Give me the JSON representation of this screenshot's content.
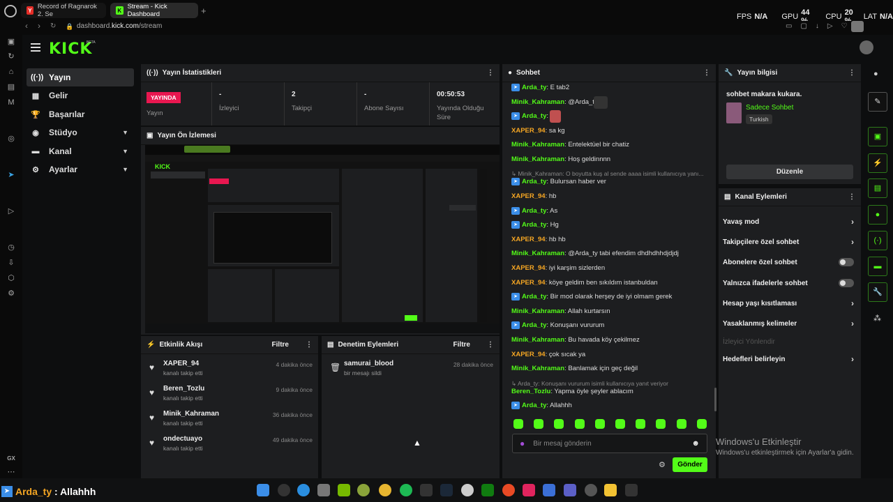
{
  "browser": {
    "tabs": [
      {
        "label": "Record of Ragnarok 2. Se",
        "favicon": "Y",
        "color": "#e52d27"
      },
      {
        "label": "Stream - Kick Dashboard",
        "favicon": "K",
        "color": "#53fc18"
      }
    ],
    "new_tab": "+",
    "url_prefix": "dashboard.",
    "url_domain": "kick.com",
    "url_path": "/stream"
  },
  "hud": {
    "fps_label": "FPS",
    "fps_value": "N/A",
    "gpu_label": "GPU",
    "gpu_value": "44 %",
    "cpu_label": "CPU",
    "cpu_value": "20 %",
    "lat_label": "LAT",
    "lat_value": "N/A"
  },
  "app": {
    "logo": "KICK",
    "logo_beta": "BETA",
    "nav": [
      {
        "label": "Yayın",
        "icon": "broadcast-icon"
      },
      {
        "label": "Gelir",
        "icon": "revenue-icon"
      },
      {
        "label": "Başarılar",
        "icon": "trophy-icon"
      },
      {
        "label": "Stüdyo",
        "icon": "studio-icon"
      },
      {
        "label": "Kanal",
        "icon": "channel-icon"
      },
      {
        "label": "Ayarlar",
        "icon": "gear-icon"
      }
    ]
  },
  "stats": {
    "title": "Yayın İstatistikleri",
    "live_badge": "YAYINDA",
    "live_label": "Yayın",
    "items": [
      {
        "value": "-",
        "label": "İzleyici"
      },
      {
        "value": "2",
        "label": "Takipçi"
      },
      {
        "value": "-",
        "label": "Abone Sayısı"
      },
      {
        "value": "00:50:53",
        "label": "Yayında Olduğu Süre"
      }
    ]
  },
  "preview": {
    "title": "Yayın Ön İzlemesi"
  },
  "activity": {
    "title": "Etkinlik Akışı",
    "filter": "Filtre",
    "items": [
      {
        "name": "XAPER_94",
        "sub": "kanalı takip etti",
        "time": "4 dakika önce"
      },
      {
        "name": "Beren_Tozlu",
        "sub": "kanalı takip etti",
        "time": "9 dakika önce"
      },
      {
        "name": "Minik_Kahraman",
        "sub": "kanalı takip etti",
        "time": "36 dakika önce"
      },
      {
        "name": "ondectuayo",
        "sub": "kanalı takip etti",
        "time": "49 dakika önce"
      }
    ]
  },
  "moderation": {
    "title": "Denetim Eylemleri",
    "filter": "Filtre",
    "items": [
      {
        "name": "samurai_blood",
        "sub": "bir mesajı sildi",
        "time": "28 dakika önce"
      }
    ]
  },
  "chat": {
    "title": "Sohbet",
    "messages": [
      {
        "user": "Arda_ty",
        "sep": ": ",
        "text": "E tab2",
        "color": "#53fc18",
        "badge": true
      },
      {
        "user": "Minik_Kahraman",
        "sep": ": ",
        "text": "@Arda_ty",
        "color": "#53fc18",
        "badge": false
      },
      {
        "user": "Arda_ty",
        "sep": ":",
        "text": "",
        "color": "#53fc18",
        "badge": true
      },
      {
        "user": "XAPER_94",
        "sep": ": ",
        "text": "sa kg",
        "color": "#f5a623",
        "badge": false
      },
      {
        "user": "Minik_Kahraman",
        "sep": ": ",
        "text": "Entelektüel bir chatiz",
        "color": "#53fc18",
        "badge": false
      },
      {
        "user": "Minik_Kahraman",
        "sep": ": ",
        "text": "Hoş geldinnnn",
        "color": "#53fc18",
        "badge": false
      },
      {
        "reply": "↳ Minik_Kahraman: O boyutta kuş al sende aaaa isimli kullanıcıya yanı..."
      },
      {
        "user": "Arda_ty",
        "sep": ": ",
        "text": "Bulursan haber ver",
        "color": "#53fc18",
        "badge": true
      },
      {
        "user": "XAPER_94",
        "sep": ": ",
        "text": "hb",
        "color": "#f5a623",
        "badge": false
      },
      {
        "user": "Arda_ty",
        "sep": ": ",
        "text": "As",
        "color": "#53fc18",
        "badge": true
      },
      {
        "user": "Arda_ty",
        "sep": ": ",
        "text": "Hg",
        "color": "#53fc18",
        "badge": true
      },
      {
        "user": "XAPER_94",
        "sep": ": ",
        "text": "hb hb",
        "color": "#f5a623",
        "badge": false
      },
      {
        "user": "Minik_Kahraman",
        "sep": ": ",
        "text": "@Arda_ty tabi efendim dhdhdhhdjdjdj",
        "color": "#53fc18",
        "badge": false
      },
      {
        "user": "XAPER_94",
        "sep": ": ",
        "text": "iyi karşim sizlerden",
        "color": "#f5a623",
        "badge": false
      },
      {
        "user": "XAPER_94",
        "sep": ": ",
        "text": "köye geldim ben sıkıldım istanbuldan",
        "color": "#f5a623",
        "badge": false
      },
      {
        "user": "Arda_ty",
        "sep": ": ",
        "text": "Bir mod olarak herşey de iyi olmam gerek",
        "color": "#53fc18",
        "badge": true
      },
      {
        "user": "Minik_Kahraman",
        "sep": ": ",
        "text": "Allah kurtarsın",
        "color": "#53fc18",
        "badge": false
      },
      {
        "user": "Arda_ty",
        "sep": ": ",
        "text": "Konuşanı vururum",
        "color": "#53fc18",
        "badge": true
      },
      {
        "user": "Minik_Kahraman",
        "sep": ": ",
        "text": "Bu havada köy çekilmez",
        "color": "#53fc18",
        "badge": false
      },
      {
        "user": "XAPER_94",
        "sep": ": ",
        "text": "çok sıcak ya",
        "color": "#f5a623",
        "badge": false
      },
      {
        "user": "Minik_Kahraman",
        "sep": ": ",
        "text": "Banlamak için geç değil",
        "color": "#53fc18",
        "badge": false
      },
      {
        "reply": "↳ Arda_ty: Konuşanı vururum isimli kullanıcıya yanıt veriyor"
      },
      {
        "user": "Beren_Tozlu",
        "sep": ": ",
        "text": "Yapma öyle şeyler ablacım",
        "color": "#53fc18",
        "badge": false
      },
      {
        "user": "Arda_ty",
        "sep": ": ",
        "text": "Allahhh",
        "color": "#53fc18",
        "badge": true
      }
    ],
    "input_placeholder": "Bir mesaj gönderin",
    "send": "Gönder"
  },
  "stream_info": {
    "title": "Yayın bilgisi",
    "stream_title": "sohbet makara kukara.",
    "category": "Sadece Sohbet",
    "language": "Turkish",
    "edit": "Düzenle"
  },
  "channel_actions": {
    "title": "Kanal Eylemleri",
    "items": [
      {
        "label": "Yavaş mod",
        "kind": "chevron"
      },
      {
        "label": "Takipçilere özel sohbet",
        "kind": "chevron"
      },
      {
        "label": "Abonelere özel sohbet",
        "kind": "toggle"
      },
      {
        "label": "Yalnızca ifadelerle sohbet",
        "kind": "toggle"
      },
      {
        "label": "Hesap yaşı kısıtlaması",
        "kind": "chevron"
      },
      {
        "label": "Yasaklanmış kelimeler",
        "kind": "chevron"
      },
      {
        "label": "İzleyici Yönlendir",
        "kind": "disabled"
      },
      {
        "label": "Hedefleri belirleyin",
        "kind": "chevron"
      }
    ]
  },
  "watermark": {
    "line1": "Windows'u Etkinleştir",
    "line2": "Windows'u etkinleştirmek için Ayarlar'a gidin."
  },
  "overlay": {
    "user": "Arda_ty",
    "text": " : Allahhh"
  },
  "opera_sidebar": {
    "label": "GX"
  }
}
